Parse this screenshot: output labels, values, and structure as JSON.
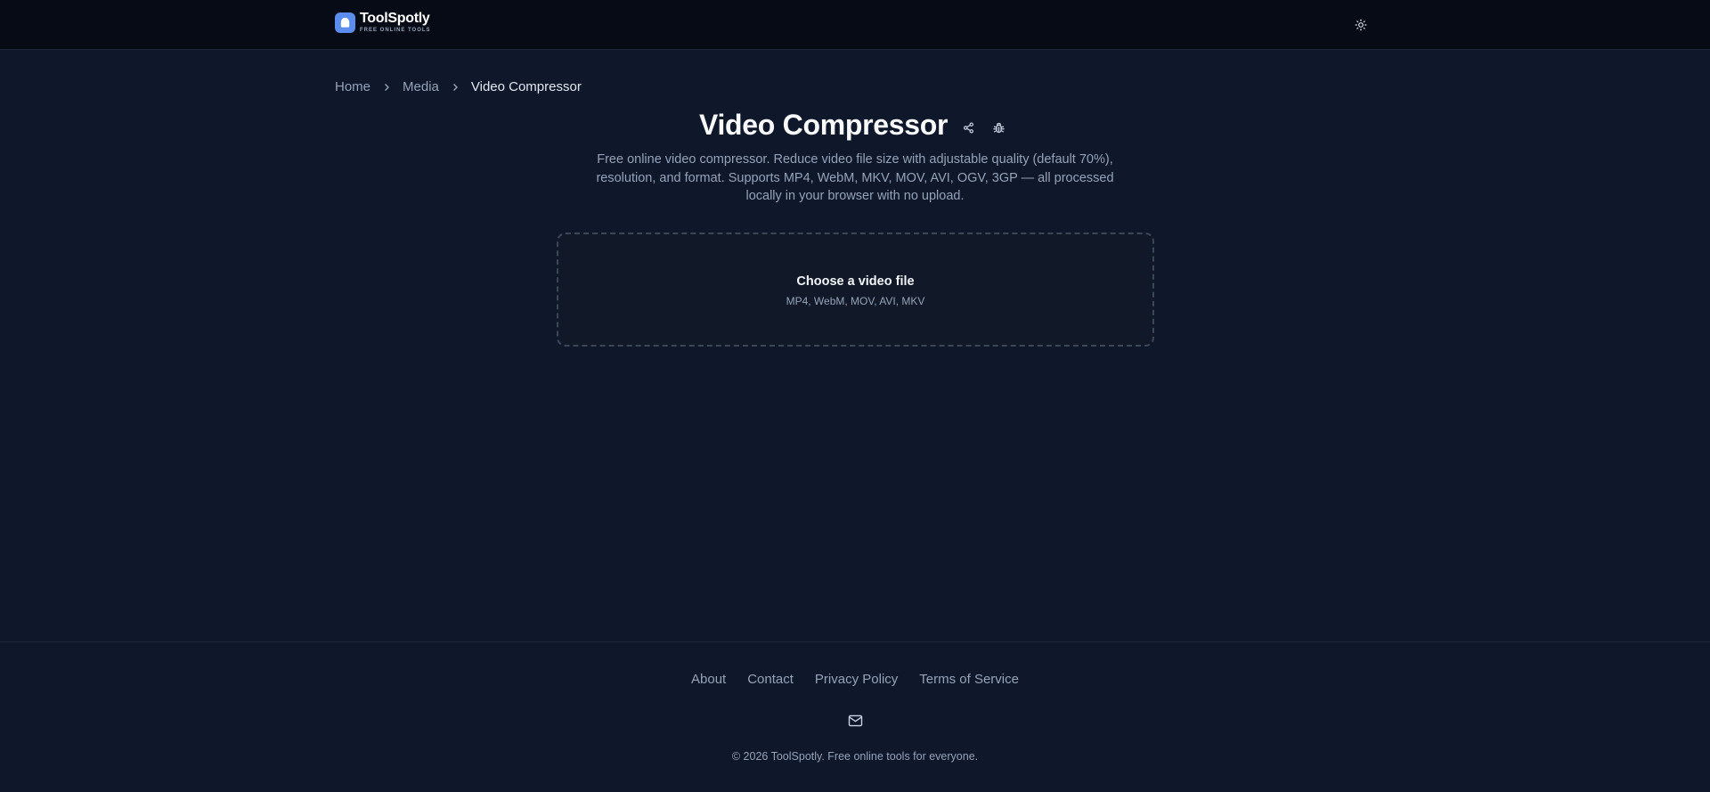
{
  "header": {
    "logo_name": "ToolSpotly",
    "logo_tagline": "FREE ONLINE TOOLS",
    "theme_icon": "sun-icon"
  },
  "breadcrumb": {
    "items": [
      "Home",
      "Media",
      "Video Compressor"
    ]
  },
  "main": {
    "title": "Video Compressor",
    "share_icon": "share-icon",
    "bug_icon": "bug-icon",
    "description": "Free online video compressor. Reduce video file size with adjustable quality (default 70%), resolution, and format. Supports MP4, WebM, MKV, MOV, AVI, OGV, 3GP — all processed locally in your browser with no upload."
  },
  "dropzone": {
    "title": "Choose a video file",
    "formats": "MP4, WebM, MOV, AVI, MKV"
  },
  "footer": {
    "links": [
      "About",
      "Contact",
      "Privacy Policy",
      "Terms of Service"
    ],
    "mail_icon": "mail-icon",
    "copyright": "© 2026 ToolSpotly. Free online tools for everyone."
  },
  "colors": {
    "background": "#0f172a",
    "topbar": "#070b16",
    "logo_accent": "#5b8def",
    "muted_text": "#94a3b8"
  }
}
